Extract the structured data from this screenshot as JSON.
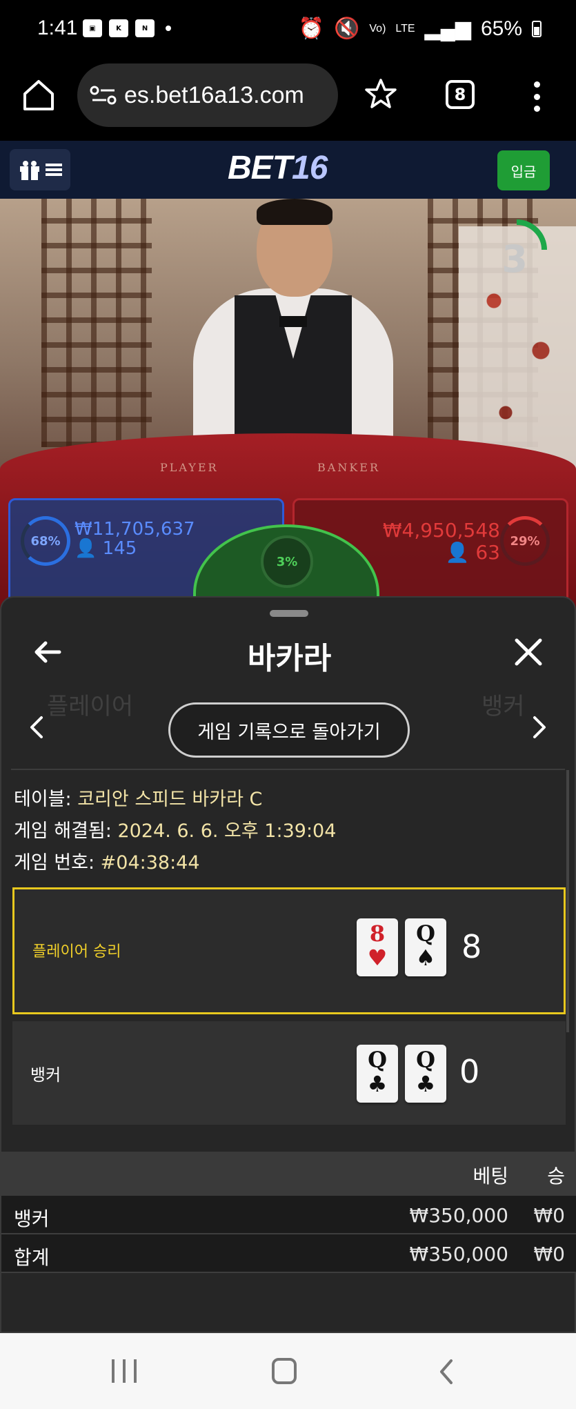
{
  "status_bar": {
    "time": "1:41",
    "network": "LTE",
    "volte": "Vo)",
    "battery": "65%",
    "icons": [
      "gallery-icon",
      "kbank-icon",
      "n-icon",
      "alarm-icon",
      "mute-icon",
      "signal-icon",
      "battery-icon"
    ]
  },
  "browser": {
    "url": "es.bet16a13.com",
    "tab_count": "8"
  },
  "header": {
    "logo_main": "BET",
    "logo_num": "16",
    "deposit_label": "입금"
  },
  "live": {
    "countdown": "3",
    "table_player_label": "PLAYER",
    "table_banker_label": "BANKER",
    "player_pct": "68%",
    "player_amount": "₩11,705,637",
    "player_count": "145",
    "tie_pct": "3%",
    "banker_pct": "29%",
    "banker_amount": "₩4,950,548",
    "banker_count": "63"
  },
  "sheet": {
    "title": "바카라",
    "history_button": "게임 기록으로 돌아가기",
    "ghost_player": "플레이어",
    "ghost_banker": "뱅커",
    "info": {
      "table_label": "테이블:",
      "table_value": "코리안 스피드 바카라 C",
      "resolved_label": "게임 해결됨:",
      "resolved_value": "2024. 6. 6. 오후 1:39:04",
      "number_label": "게임 번호:",
      "number_value": "#04:38:44"
    },
    "results": [
      {
        "label": "플레이어 승리",
        "cards": [
          {
            "rank": "8",
            "suit": "♥",
            "color": "red"
          },
          {
            "rank": "Q",
            "suit": "♠",
            "color": "black"
          }
        ],
        "score": "8"
      },
      {
        "label": "뱅커",
        "cards": [
          {
            "rank": "Q",
            "suit": "♣",
            "color": "black"
          },
          {
            "rank": "Q",
            "suit": "♣",
            "color": "black"
          }
        ],
        "score": "0"
      }
    ],
    "bets": {
      "col_bet": "베팅",
      "col_win": "승",
      "rows": [
        {
          "name": "뱅커",
          "bet": "₩350,000",
          "win": "₩0"
        },
        {
          "name": "합계",
          "bet": "₩350,000",
          "win": "₩0"
        }
      ]
    }
  },
  "colors": {
    "win_border": "#e8c81e",
    "deposit": "#1f9d35",
    "player_blue": "#2e5bd8",
    "banker_red": "#b3262d",
    "tie_green": "#43c34c"
  }
}
